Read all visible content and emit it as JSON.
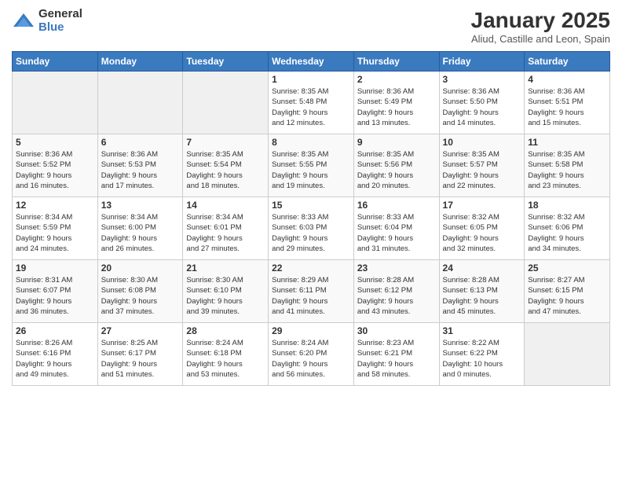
{
  "logo": {
    "general": "General",
    "blue": "Blue"
  },
  "header": {
    "month": "January 2025",
    "location": "Aliud, Castille and Leon, Spain"
  },
  "weekdays": [
    "Sunday",
    "Monday",
    "Tuesday",
    "Wednesday",
    "Thursday",
    "Friday",
    "Saturday"
  ],
  "weeks": [
    [
      {
        "day": "",
        "info": ""
      },
      {
        "day": "",
        "info": ""
      },
      {
        "day": "",
        "info": ""
      },
      {
        "day": "1",
        "info": "Sunrise: 8:35 AM\nSunset: 5:48 PM\nDaylight: 9 hours\nand 12 minutes."
      },
      {
        "day": "2",
        "info": "Sunrise: 8:36 AM\nSunset: 5:49 PM\nDaylight: 9 hours\nand 13 minutes."
      },
      {
        "day": "3",
        "info": "Sunrise: 8:36 AM\nSunset: 5:50 PM\nDaylight: 9 hours\nand 14 minutes."
      },
      {
        "day": "4",
        "info": "Sunrise: 8:36 AM\nSunset: 5:51 PM\nDaylight: 9 hours\nand 15 minutes."
      }
    ],
    [
      {
        "day": "5",
        "info": "Sunrise: 8:36 AM\nSunset: 5:52 PM\nDaylight: 9 hours\nand 16 minutes."
      },
      {
        "day": "6",
        "info": "Sunrise: 8:36 AM\nSunset: 5:53 PM\nDaylight: 9 hours\nand 17 minutes."
      },
      {
        "day": "7",
        "info": "Sunrise: 8:35 AM\nSunset: 5:54 PM\nDaylight: 9 hours\nand 18 minutes."
      },
      {
        "day": "8",
        "info": "Sunrise: 8:35 AM\nSunset: 5:55 PM\nDaylight: 9 hours\nand 19 minutes."
      },
      {
        "day": "9",
        "info": "Sunrise: 8:35 AM\nSunset: 5:56 PM\nDaylight: 9 hours\nand 20 minutes."
      },
      {
        "day": "10",
        "info": "Sunrise: 8:35 AM\nSunset: 5:57 PM\nDaylight: 9 hours\nand 22 minutes."
      },
      {
        "day": "11",
        "info": "Sunrise: 8:35 AM\nSunset: 5:58 PM\nDaylight: 9 hours\nand 23 minutes."
      }
    ],
    [
      {
        "day": "12",
        "info": "Sunrise: 8:34 AM\nSunset: 5:59 PM\nDaylight: 9 hours\nand 24 minutes."
      },
      {
        "day": "13",
        "info": "Sunrise: 8:34 AM\nSunset: 6:00 PM\nDaylight: 9 hours\nand 26 minutes."
      },
      {
        "day": "14",
        "info": "Sunrise: 8:34 AM\nSunset: 6:01 PM\nDaylight: 9 hours\nand 27 minutes."
      },
      {
        "day": "15",
        "info": "Sunrise: 8:33 AM\nSunset: 6:03 PM\nDaylight: 9 hours\nand 29 minutes."
      },
      {
        "day": "16",
        "info": "Sunrise: 8:33 AM\nSunset: 6:04 PM\nDaylight: 9 hours\nand 31 minutes."
      },
      {
        "day": "17",
        "info": "Sunrise: 8:32 AM\nSunset: 6:05 PM\nDaylight: 9 hours\nand 32 minutes."
      },
      {
        "day": "18",
        "info": "Sunrise: 8:32 AM\nSunset: 6:06 PM\nDaylight: 9 hours\nand 34 minutes."
      }
    ],
    [
      {
        "day": "19",
        "info": "Sunrise: 8:31 AM\nSunset: 6:07 PM\nDaylight: 9 hours\nand 36 minutes."
      },
      {
        "day": "20",
        "info": "Sunrise: 8:30 AM\nSunset: 6:08 PM\nDaylight: 9 hours\nand 37 minutes."
      },
      {
        "day": "21",
        "info": "Sunrise: 8:30 AM\nSunset: 6:10 PM\nDaylight: 9 hours\nand 39 minutes."
      },
      {
        "day": "22",
        "info": "Sunrise: 8:29 AM\nSunset: 6:11 PM\nDaylight: 9 hours\nand 41 minutes."
      },
      {
        "day": "23",
        "info": "Sunrise: 8:28 AM\nSunset: 6:12 PM\nDaylight: 9 hours\nand 43 minutes."
      },
      {
        "day": "24",
        "info": "Sunrise: 8:28 AM\nSunset: 6:13 PM\nDaylight: 9 hours\nand 45 minutes."
      },
      {
        "day": "25",
        "info": "Sunrise: 8:27 AM\nSunset: 6:15 PM\nDaylight: 9 hours\nand 47 minutes."
      }
    ],
    [
      {
        "day": "26",
        "info": "Sunrise: 8:26 AM\nSunset: 6:16 PM\nDaylight: 9 hours\nand 49 minutes."
      },
      {
        "day": "27",
        "info": "Sunrise: 8:25 AM\nSunset: 6:17 PM\nDaylight: 9 hours\nand 51 minutes."
      },
      {
        "day": "28",
        "info": "Sunrise: 8:24 AM\nSunset: 6:18 PM\nDaylight: 9 hours\nand 53 minutes."
      },
      {
        "day": "29",
        "info": "Sunrise: 8:24 AM\nSunset: 6:20 PM\nDaylight: 9 hours\nand 56 minutes."
      },
      {
        "day": "30",
        "info": "Sunrise: 8:23 AM\nSunset: 6:21 PM\nDaylight: 9 hours\nand 58 minutes."
      },
      {
        "day": "31",
        "info": "Sunrise: 8:22 AM\nSunset: 6:22 PM\nDaylight: 10 hours\nand 0 minutes."
      },
      {
        "day": "",
        "info": ""
      }
    ]
  ]
}
